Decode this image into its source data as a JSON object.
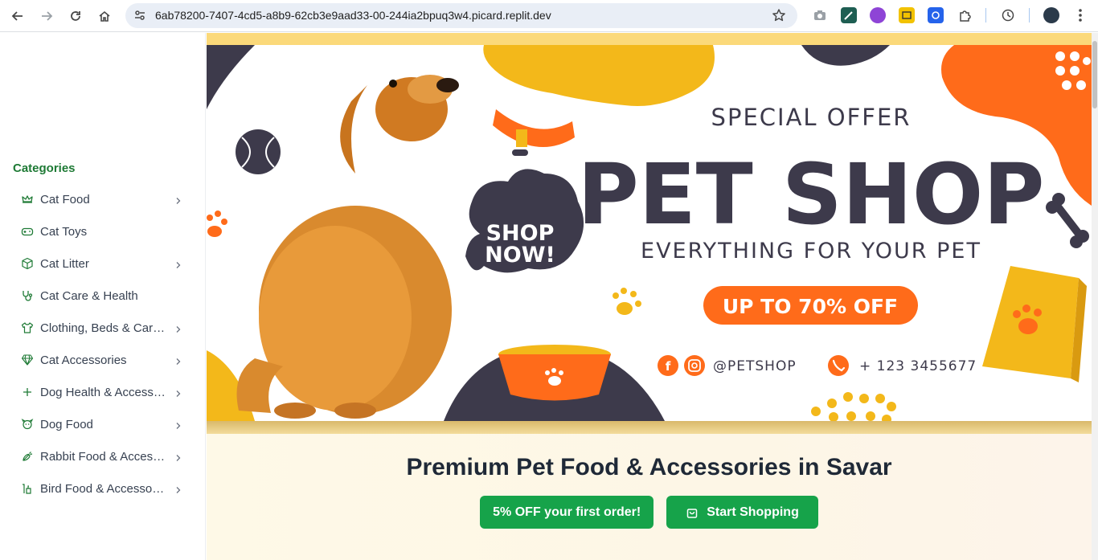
{
  "browser": {
    "url": "6ab78200-7407-4cd5-a8b9-62cb3e9aad33-00-244ia2bpuq3w4.picard.replit.dev",
    "icons": [
      "back-icon",
      "forward-icon",
      "reload-icon",
      "home-icon",
      "site-info-icon",
      "bookmark-star-icon",
      "camera-icon",
      "extension-icons",
      "puzzle-icon",
      "history-icon",
      "profile-avatar",
      "menu-icon"
    ]
  },
  "sidebar": {
    "title": "Categories",
    "items": [
      {
        "label": "Cat Food",
        "icon": "crown-icon",
        "has_submenu": true
      },
      {
        "label": "Cat Toys",
        "icon": "gamepad-icon",
        "has_submenu": false
      },
      {
        "label": "Cat Litter",
        "icon": "box-icon",
        "has_submenu": true
      },
      {
        "label": "Cat Care & Health",
        "icon": "stethoscope-icon",
        "has_submenu": false
      },
      {
        "label": "Clothing, Beds & Carriers",
        "icon": "shirt-icon",
        "has_submenu": true
      },
      {
        "label": "Cat Accessories",
        "icon": "gem-icon",
        "has_submenu": true
      },
      {
        "label": "Dog Health & Accessories",
        "icon": "plus-icon",
        "has_submenu": true
      },
      {
        "label": "Dog Food",
        "icon": "dog-icon",
        "has_submenu": true
      },
      {
        "label": "Rabbit Food & Accessories",
        "icon": "carrot-icon",
        "has_submenu": true
      },
      {
        "label": "Bird Food & Accessories",
        "icon": "bird-icon",
        "has_submenu": true
      }
    ]
  },
  "banner": {
    "special_offer": "SPECIAL OFFER",
    "title": "PET SHOP",
    "tagline": "EVERYTHING FOR YOUR PET",
    "discount": "UP TO 70% OFF",
    "shop_now_line1": "SHOP",
    "shop_now_line2": "NOW!",
    "social_handle": "@PETSHOP",
    "phone": "+ 123 3455677"
  },
  "hero": {
    "heading": "Premium Pet Food & Accessories in Savar",
    "offer_button": "5% OFF your first order!",
    "shop_button": "Start Shopping"
  },
  "colors": {
    "accent_green": "#16a34a",
    "category_title_green": "#1e7a35",
    "banner_orange": "#ff6b1a",
    "banner_yellow": "#f3b81a",
    "banner_navy": "#3d3a4b"
  }
}
